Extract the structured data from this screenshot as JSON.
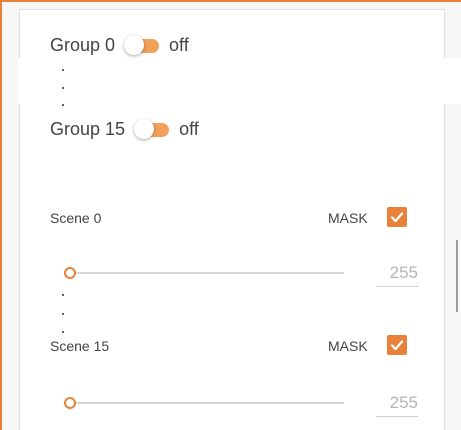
{
  "groups": [
    {
      "label": "Group 0",
      "state": "off"
    },
    {
      "label": "Group 15",
      "state": "off"
    }
  ],
  "scenes": [
    {
      "label": "Scene 0",
      "mask_label": "MASK",
      "mask_checked": true,
      "value": "255",
      "level": 0
    },
    {
      "label": "Scene 15",
      "mask_label": "MASK",
      "mask_checked": true,
      "value": "255",
      "level": 0
    }
  ],
  "colors": {
    "accent": "#e8813a",
    "toggle_track": "#f0a058"
  },
  "icons": {
    "checkmark": "check-icon"
  }
}
